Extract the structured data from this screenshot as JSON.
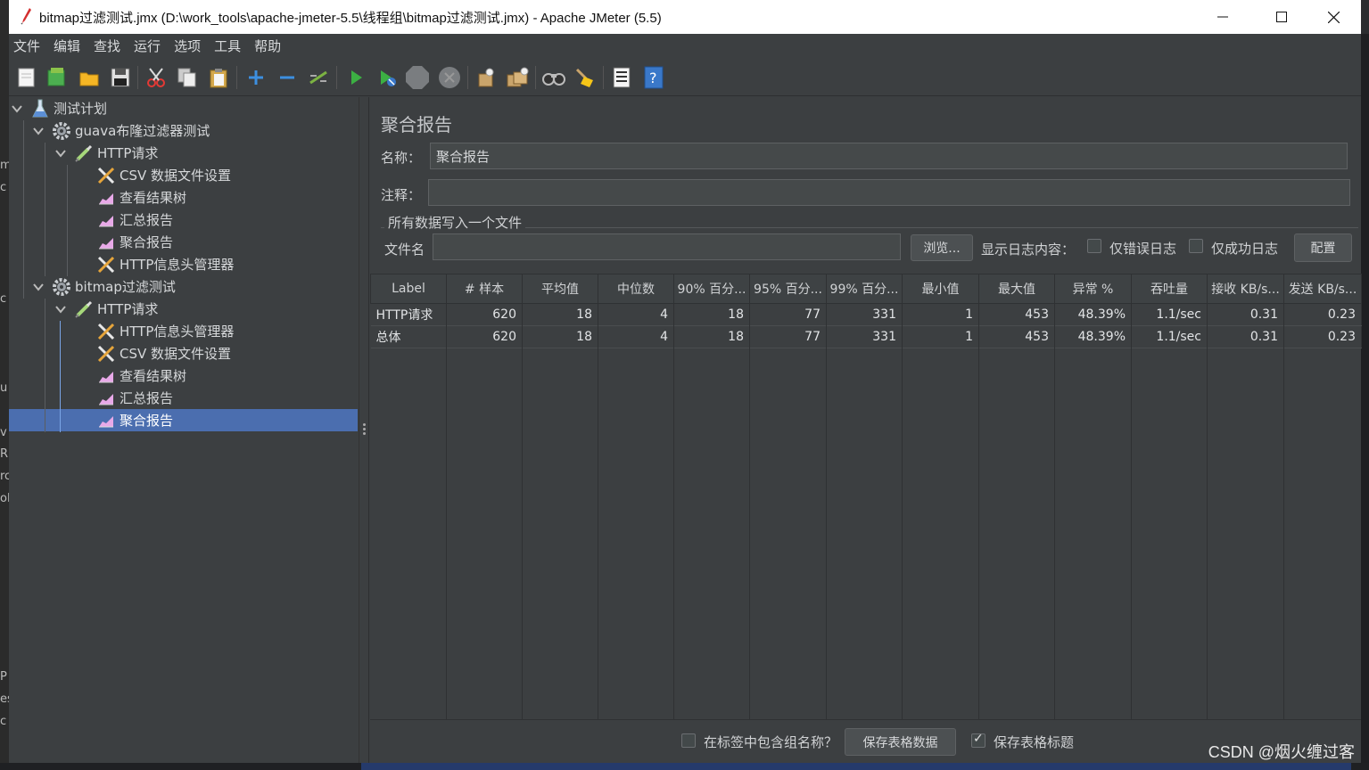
{
  "window": {
    "title": "bitmap过滤测试.jmx (D:\\work_tools\\apache-jmeter-5.5\\线程组\\bitmap过滤测试.jmx) - Apache JMeter (5.5)"
  },
  "menu": [
    "文件",
    "编辑",
    "查找",
    "运行",
    "选项",
    "工具",
    "帮助"
  ],
  "toolbar": [
    "new-icon",
    "templates-icon",
    "open-icon",
    "save-icon",
    "cut-icon",
    "copy-icon",
    "paste-icon",
    "expand-icon",
    "collapse-icon",
    "toggle-icon",
    "start-icon",
    "start-no-pause-icon",
    "stop-icon",
    "shutdown-icon",
    "clear-icon",
    "clear-all-icon",
    "search-icon",
    "reset-search-icon",
    "function-helper-icon",
    "help-icon"
  ],
  "tree": {
    "root": "测试计划",
    "groups": [
      {
        "name": "guava布隆过滤器测试",
        "sampler": "HTTP请求",
        "children": [
          "CSV 数据文件设置",
          "查看结果树",
          "汇总报告",
          "聚合报告",
          "HTTP信息头管理器"
        ]
      },
      {
        "name": "bitmap过滤测试",
        "sampler": "HTTP请求",
        "children": [
          "HTTP信息头管理器",
          "CSV 数据文件设置",
          "查看结果树",
          "汇总报告",
          "聚合报告"
        ]
      }
    ]
  },
  "panel": {
    "title": "聚合报告",
    "name_label": "名称：",
    "name_value": "聚合报告",
    "comment_label": "注释：",
    "comment_value": "",
    "file_section": "所有数据写入一个文件",
    "filename_label": "文件名",
    "filename_value": "",
    "browse_button": "浏览...",
    "log_label": "显示日志内容：",
    "errors_only": "仅错误日志",
    "success_only": "仅成功日志",
    "configure_button": "配置"
  },
  "table": {
    "columns": [
      "Label",
      "# 样本",
      "平均值",
      "中位数",
      "90% 百分...",
      "95% 百分...",
      "99% 百分...",
      "最小值",
      "最大值",
      "异常 %",
      "吞吐量",
      "接收 KB/s...",
      "发送 KB/s..."
    ],
    "rows": [
      [
        "HTTP请求",
        "620",
        "18",
        "4",
        "18",
        "77",
        "331",
        "1",
        "453",
        "48.39%",
        "1.1/sec",
        "0.31",
        "0.23"
      ],
      [
        "总体",
        "620",
        "18",
        "4",
        "18",
        "77",
        "331",
        "1",
        "453",
        "48.39%",
        "1.1/sec",
        "0.31",
        "0.23"
      ]
    ]
  },
  "bottom": {
    "include_group_name": "在标签中包含组名称？",
    "save_table": "保存表格数据",
    "save_header": "保存表格标题",
    "save_header_checked": true
  },
  "watermark": "CSDN @烟火缠过客",
  "desktop_edge": [
    "m",
    "c",
    "c",
    "u",
    "v",
    "R",
    "rc",
    "ol",
    "P",
    "es",
    "c"
  ]
}
